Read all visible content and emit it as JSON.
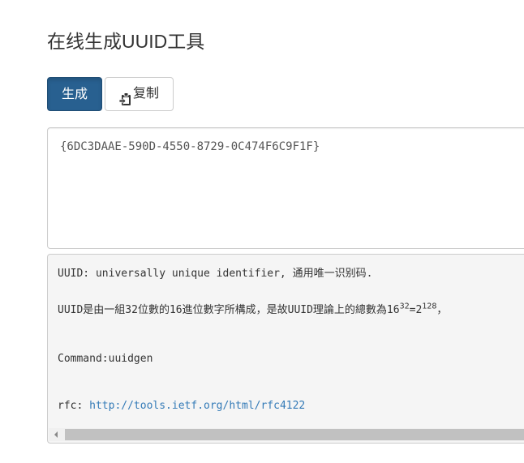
{
  "page": {
    "title": "在线生成UUID工具"
  },
  "toolbar": {
    "generate_label": "生成",
    "copy_label": "复制",
    "copy_icon": "clipboard-icon"
  },
  "output": {
    "uuid": "{6DC3DAAE-590D-4550-8729-0C474F6C9F1F}"
  },
  "info": {
    "line1": "UUID: universally unique identifier, 通用唯一识别码.",
    "line2_prefix": "UUID是由一組32位數的16進位數字所構成，是故UUID理論上的總數為16",
    "line2_exp1": "32",
    "line2_mid": "=2",
    "line2_exp2": "128",
    "line2_suffix": "，",
    "command_label": "Command:",
    "command_value": "uuidgen",
    "rfc_label": "rfc: ",
    "rfc_link": "http://tools.ietf.org/html/rfc4122"
  },
  "colors": {
    "primary": "#286090",
    "link": "#337ab7",
    "pre_background": "#f5f5f5"
  }
}
